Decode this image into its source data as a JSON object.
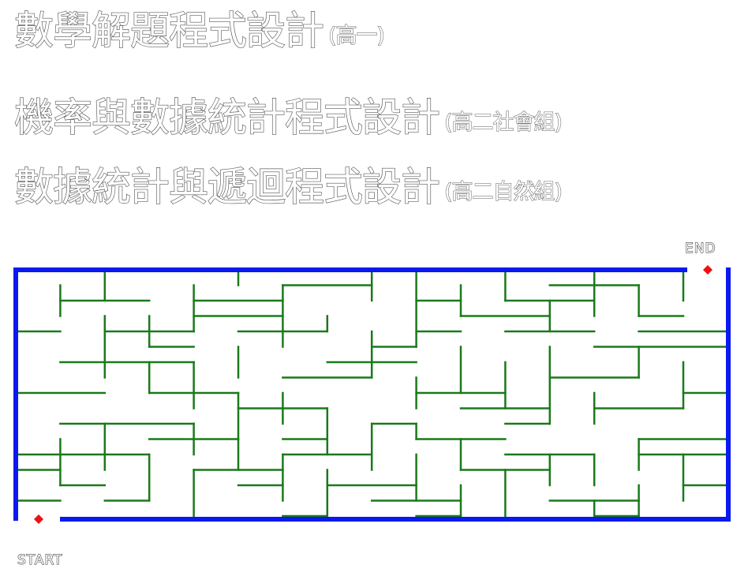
{
  "menu": [
    {
      "title": "數學解題程式設計",
      "sub": "(高一)"
    },
    {
      "title": "機率與數據統計程式設計",
      "sub": "(高二社會組)"
    },
    {
      "title": "數據統計與遞迴程式設計",
      "sub": "(高二自然組)"
    }
  ],
  "maze": {
    "end_label": "END",
    "start_label": "START",
    "colors": {
      "border": "#0a1aee",
      "walls": "#1a7a1a",
      "marker": "#ee1111"
    }
  }
}
